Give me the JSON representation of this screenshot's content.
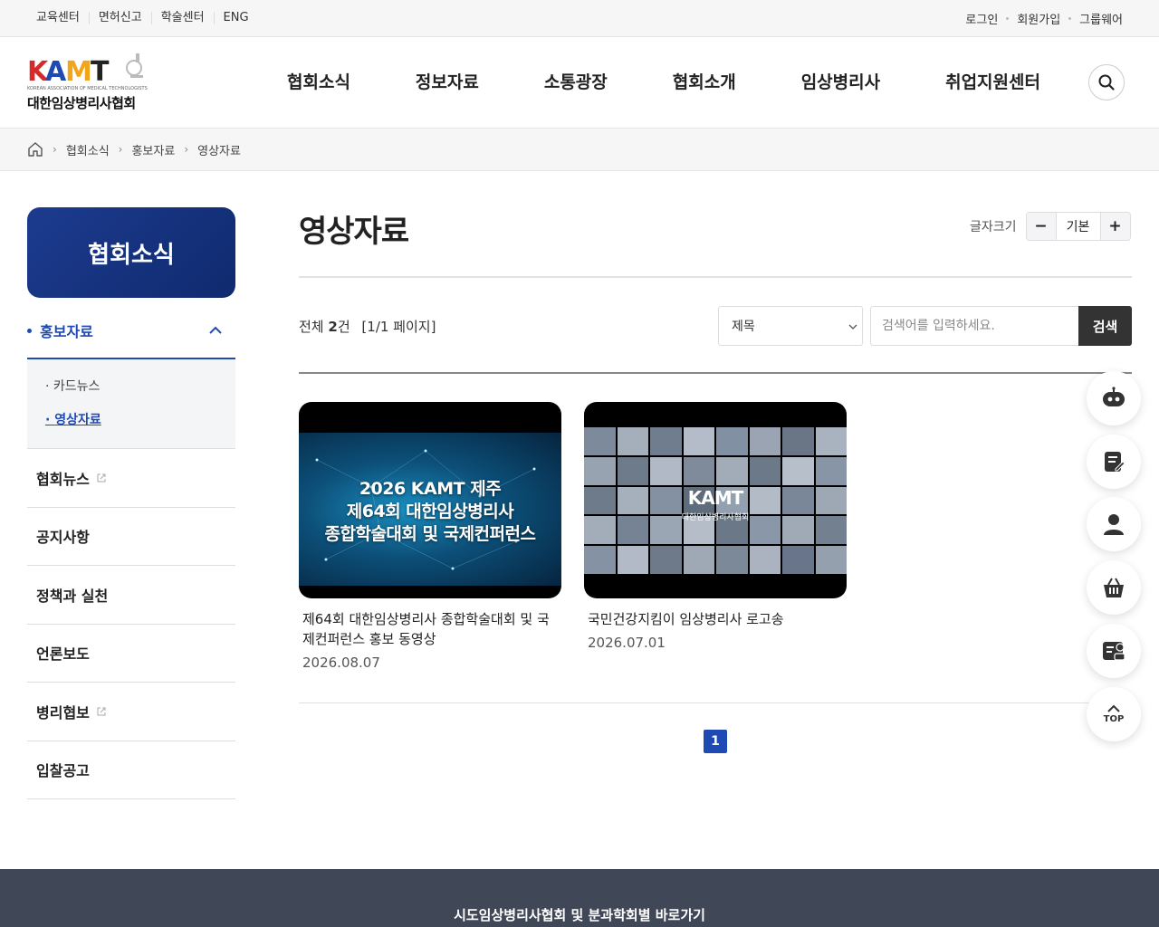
{
  "util_links": [
    "교육센터",
    "면허신고",
    "학술센터",
    "ENG"
  ],
  "util_right": {
    "login": "로그인",
    "join": "회원가입",
    "groupware": "그룹웨어"
  },
  "logo": {
    "mark": "KAMT",
    "sub": "KOREAN ASSOCIATION OF MEDICAL TECHNOLOGISTS",
    "name": "대한임상병리사협회"
  },
  "gnb": [
    "협회소식",
    "정보자료",
    "소통광장",
    "협회소개",
    "임상병리사",
    "취업지원센터"
  ],
  "breadcrumb": [
    "협회소식",
    "홍보자료",
    "영상자료"
  ],
  "sidebar": {
    "title": "협회소식",
    "active": "홍보자료",
    "sub_items": [
      "카드뉴스",
      "영상자료"
    ],
    "items": [
      "협회뉴스",
      "공지사항",
      "정책과 실천",
      "언론보도",
      "병리협보",
      "입찰공고"
    ]
  },
  "page_title": "영상자료",
  "font_size": {
    "label": "글자크기",
    "minus": "−",
    "base": "기본",
    "plus": "+"
  },
  "list_info": {
    "prefix": "전체",
    "count": "2",
    "suffix": "건",
    "page": "[1/1 페이지]"
  },
  "search": {
    "select_value": "제목",
    "placeholder": "검색어를 입력하세요.",
    "button": "검색"
  },
  "videos": [
    {
      "thumb_text": "2026 KAMT 제주\n제64회 대한임상병리사\n종합학술대회 및 국제컨퍼런스",
      "title": "제64회 대한임상병리사 종합학술대회 및 국제컨퍼런스 홍보 동영상",
      "date": "2026.08.07"
    },
    {
      "thumb_mark": "KAMT",
      "thumb_name": "대한임상병리사협회",
      "title": "국민건강지킴이 임상병리사 로고송",
      "date": "2026.07.01"
    }
  ],
  "pagination": {
    "current": "1"
  },
  "quick_top_label": "TOP",
  "footer_text": "시도임상병리사협회 및 분과학회별 바로가기"
}
